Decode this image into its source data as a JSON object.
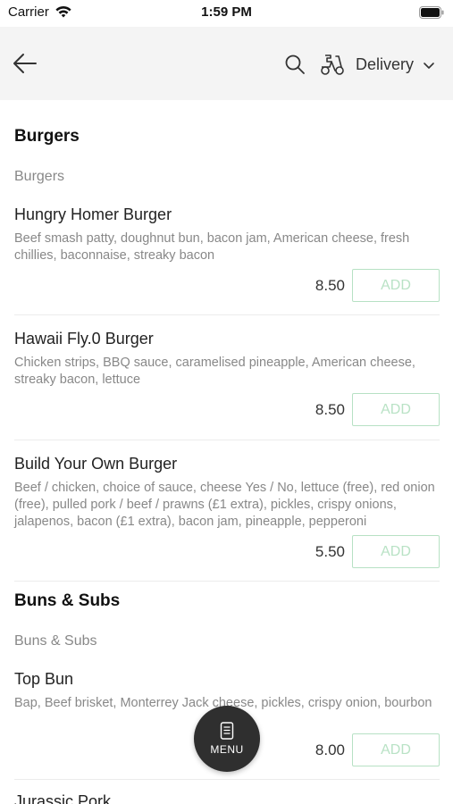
{
  "status_bar": {
    "carrier": "Carrier",
    "time": "1:59 PM"
  },
  "header": {
    "back_icon": "arrow-left-icon",
    "search_icon": "search-icon",
    "delivery_icon": "scooter-icon",
    "delivery_label": "Delivery",
    "dropdown_icon": "chevron-down-icon"
  },
  "menu": {
    "sections": [
      {
        "title": "Burgers",
        "subtitle": "Burgers",
        "items": [
          {
            "name": "Hungry Homer Burger",
            "description": "Beef smash patty, doughnut bun, bacon jam, American cheese, fresh chillies, baconnaise, streaky bacon",
            "price": "8.50",
            "add_label": "ADD"
          },
          {
            "name": "Hawaii Fly.0 Burger",
            "description": "Chicken strips, BBQ sauce, caramelised pineapple, American cheese, streaky bacon, lettuce",
            "price": "8.50",
            "add_label": "ADD"
          },
          {
            "name": "Build Your Own Burger",
            "description": "Beef / chicken, choice of sauce, cheese Yes / No, lettuce (free), red onion (free), pulled pork / beef / prawns (£1 extra), pickles, crispy onions, jalapenos, bacon (£1 extra), bacon jam, pineapple, pepperoni",
            "price": "5.50",
            "add_label": "ADD"
          }
        ]
      },
      {
        "title": "Buns & Subs",
        "subtitle": "Buns & Subs",
        "items": [
          {
            "name": "Top Bun",
            "description": "Bap, Beef brisket, Monterrey Jack cheese, pickles, crispy onion, bourbon",
            "price": "8.00",
            "add_label": "ADD"
          },
          {
            "name": "Jurassic Pork"
          }
        ]
      }
    ]
  },
  "fab": {
    "icon": "phone-menu-icon",
    "label": "MENU"
  },
  "colors": {
    "header_bg": "#f4f4f4",
    "add_button_accent": "#b7e1c4",
    "fab_bg": "#2f2f2f"
  }
}
